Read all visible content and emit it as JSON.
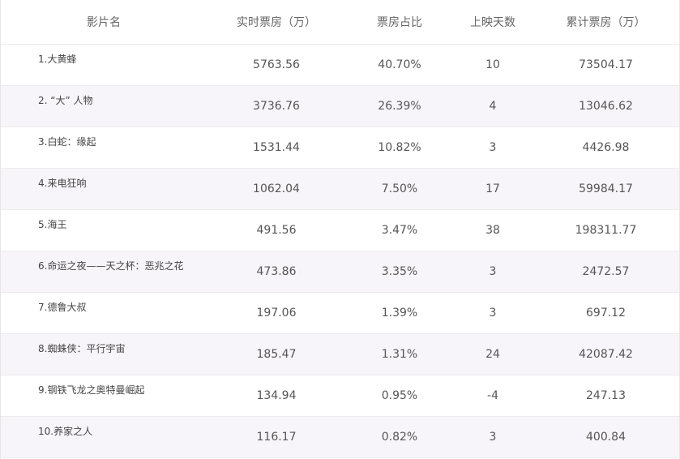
{
  "table": {
    "headers": [
      "影片名",
      "实时票房（万）",
      "票房占比",
      "上映天数",
      "累计票房（万）"
    ],
    "rows": [
      {
        "name": "1.大黄蜂",
        "realtime": "5763.56",
        "share": "40.70%",
        "days": "10",
        "total": "73504.17"
      },
      {
        "name": "2. “大” 人物",
        "realtime": "3736.76",
        "share": "26.39%",
        "days": "4",
        "total": "13046.62"
      },
      {
        "name": "3.白蛇：缘起",
        "realtime": "1531.44",
        "share": "10.82%",
        "days": "3",
        "total": "4426.98"
      },
      {
        "name": "4.来电狂响",
        "realtime": "1062.04",
        "share": "7.50%",
        "days": "17",
        "total": "59984.17"
      },
      {
        "name": "5.海王",
        "realtime": "491.56",
        "share": "3.47%",
        "days": "38",
        "total": "198311.77"
      },
      {
        "name": "6.命运之夜——天之杯：恶兆之花",
        "realtime": "473.86",
        "share": "3.35%",
        "days": "3",
        "total": "2472.57"
      },
      {
        "name": "7.德鲁大叔",
        "realtime": "197.06",
        "share": "1.39%",
        "days": "3",
        "total": "697.12"
      },
      {
        "name": "8.蜘蛛侠：平行宇宙",
        "realtime": "185.47",
        "share": "1.31%",
        "days": "24",
        "total": "42087.42"
      },
      {
        "name": "9.钢铁飞龙之奥特曼崛起",
        "realtime": "134.94",
        "share": "0.95%",
        "days": "-4",
        "total": "247.13"
      },
      {
        "name": "10.养家之人",
        "realtime": "116.17",
        "share": "0.82%",
        "days": "3",
        "total": "400.84"
      }
    ]
  },
  "colors": {
    "row_alt_background": "#f7f5fa",
    "border": "#ececec",
    "text": "#555555"
  }
}
